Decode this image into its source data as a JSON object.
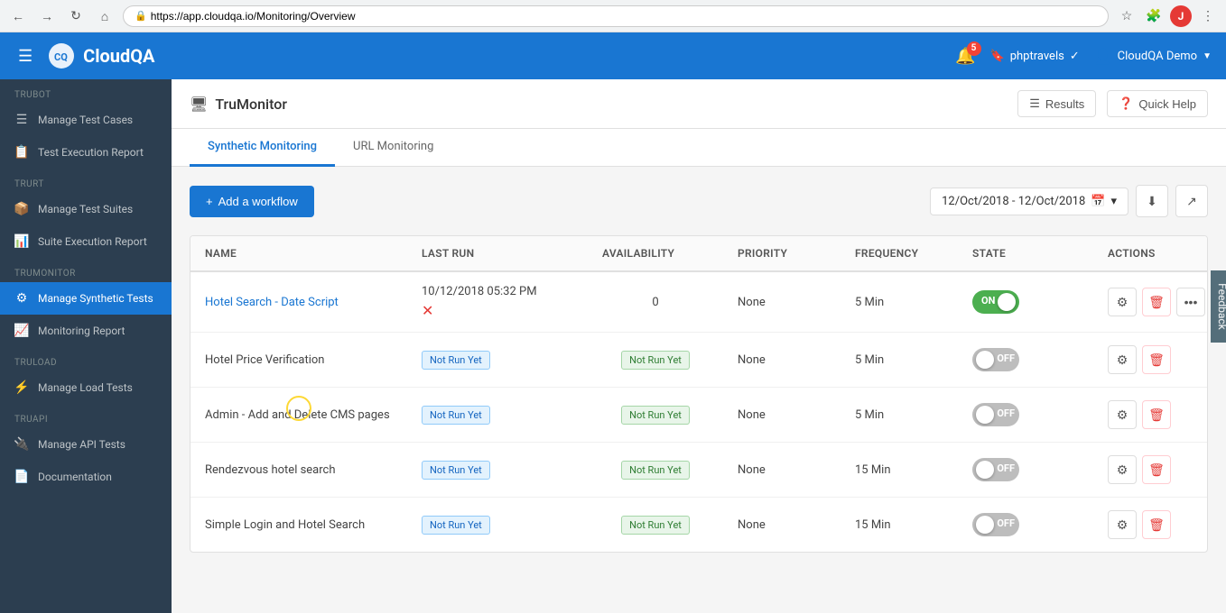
{
  "browser": {
    "url": "https://app.cloudqa.io/Monitoring/Overview",
    "profile_initial": "J"
  },
  "topnav": {
    "logo_text": "CloudQA",
    "notification_count": "5",
    "bookmark_label": "phptravels",
    "user_label": "CloudQA Demo"
  },
  "sidebar": {
    "sections": [
      {
        "label": "TruBot",
        "items": [
          {
            "icon": "☰",
            "label": "Manage Test Cases",
            "active": false
          },
          {
            "icon": "📋",
            "label": "Test Execution Report",
            "active": false
          }
        ]
      },
      {
        "label": "TruRT",
        "items": [
          {
            "icon": "📦",
            "label": "Manage Test Suites",
            "active": false
          },
          {
            "icon": "📊",
            "label": "Suite Execution Report",
            "active": false
          }
        ]
      },
      {
        "label": "TruMonitor",
        "items": [
          {
            "icon": "⚙",
            "label": "Manage Synthetic Tests",
            "active": true
          },
          {
            "icon": "📈",
            "label": "Monitoring Report",
            "active": false
          }
        ]
      },
      {
        "label": "TruLoad",
        "items": [
          {
            "icon": "⚡",
            "label": "Manage Load Tests",
            "active": false
          }
        ]
      },
      {
        "label": "TruAPI",
        "items": [
          {
            "icon": "🔌",
            "label": "Manage API Tests",
            "active": false
          },
          {
            "icon": "📄",
            "label": "Documentation",
            "active": false
          }
        ]
      }
    ]
  },
  "page": {
    "title": "TruMonitor",
    "results_label": "Results",
    "quick_help_label": "Quick Help",
    "tabs": [
      {
        "label": "Synthetic Monitoring",
        "active": true
      },
      {
        "label": "URL Monitoring",
        "active": false
      }
    ],
    "add_workflow_label": "+ Add a workflow",
    "date_range": "12/Oct/2018 - 12/Oct/2018",
    "table": {
      "columns": [
        "Name",
        "Last Run",
        "Availability",
        "Priority",
        "Frequency",
        "State",
        "Actions"
      ],
      "rows": [
        {
          "name": "Hotel Search - Date Script",
          "name_link": true,
          "last_run": "10/12/2018 05:32 PM",
          "last_run_error": true,
          "availability": "0",
          "availability_badge": false,
          "priority": "None",
          "frequency": "5 Min",
          "state": "on",
          "actions": [
            "settings",
            "delete",
            "more"
          ]
        },
        {
          "name": "Hotel Price Verification",
          "name_link": false,
          "last_run": "Not Run Yet",
          "last_run_error": false,
          "availability": "Not Run Yet",
          "availability_badge": true,
          "priority": "None",
          "frequency": "5 Min",
          "state": "off",
          "actions": [
            "settings",
            "delete"
          ]
        },
        {
          "name": "Admin - Add and Delete CMS pages",
          "name_link": false,
          "last_run": "Not Run Yet",
          "last_run_error": false,
          "availability": "Not Run Yet",
          "availability_badge": true,
          "priority": "None",
          "frequency": "5 Min",
          "state": "off",
          "actions": [
            "settings",
            "delete"
          ]
        },
        {
          "name": "Rendezvous hotel search",
          "name_link": false,
          "last_run": "Not Run Yet",
          "last_run_error": false,
          "availability": "Not Run Yet",
          "availability_badge": true,
          "priority": "None",
          "frequency": "15 Min",
          "state": "off",
          "actions": [
            "settings",
            "delete"
          ]
        },
        {
          "name": "Simple Login and Hotel Search",
          "name_link": false,
          "last_run": "Not Run Yet",
          "last_run_error": false,
          "availability": "Not Run Yet",
          "availability_badge": true,
          "priority": "None",
          "frequency": "15 Min",
          "state": "off",
          "actions": [
            "settings",
            "delete"
          ]
        }
      ]
    }
  },
  "feedback": {
    "label": "Feedback"
  }
}
